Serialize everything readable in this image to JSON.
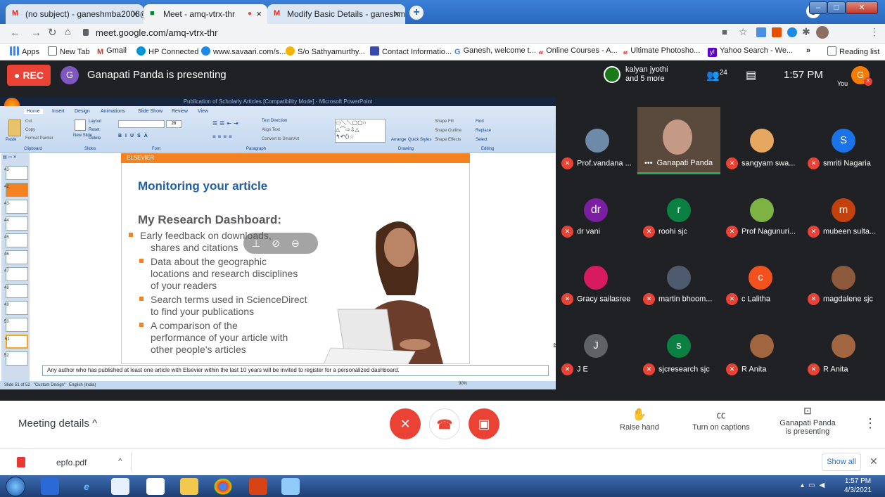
{
  "browser": {
    "tabs": [
      {
        "title": "(no subject) - ganeshmba2008@",
        "icon": "gmail-icon",
        "active": false
      },
      {
        "title": "Meet - amq-vtrx-thr",
        "icon": "meet-icon",
        "active": true
      },
      {
        "title": "Modify Basic Details - ganeshmb",
        "icon": "gmail-icon",
        "active": false
      }
    ],
    "url": "meet.google.com/amq-vtrx-thr",
    "bookmarks": [
      {
        "label": "Apps",
        "icon": "apps-icon"
      },
      {
        "label": "New Tab",
        "icon": "newtab-icon"
      },
      {
        "label": "Gmail",
        "icon": "gmail-icon"
      },
      {
        "label": "HP Connected",
        "icon": "hp-icon"
      },
      {
        "label": "www.savaari.com/s...",
        "icon": "savaari-icon"
      },
      {
        "label": "S/o Sathyamurthy...",
        "icon": "person-icon"
      },
      {
        "label": "Contact Informatio...",
        "icon": "sheet-icon"
      },
      {
        "label": "Ganesh, welcome t...",
        "icon": "google-icon"
      },
      {
        "label": "Online Courses - A...",
        "icon": "udemy-icon"
      },
      {
        "label": "Ultimate Photosho...",
        "icon": "udemy-icon"
      },
      {
        "label": "Yahoo Search - We...",
        "icon": "yahoo-icon"
      }
    ],
    "bookmarks_overflow": "»",
    "reading_list": "Reading list"
  },
  "meet": {
    "rec_label": "REC",
    "presenter_initial": "G",
    "presenter_status": "Ganapati Panda is presenting",
    "pinned": {
      "name": "kalyan jyothi",
      "more": "and 5 more"
    },
    "participants_count": "24",
    "time": "1:57 PM",
    "self_label": "You",
    "self_initial": "G"
  },
  "ppt": {
    "window_title": "Publication of Scholarly Articles [Compatibility Mode] - Microsoft PowerPoint",
    "ribbon_tabs": [
      "Home",
      "Insert",
      "Design",
      "Animations",
      "Slide Show",
      "Review",
      "View"
    ],
    "ribbon_groups": [
      "Clipboard",
      "Slides",
      "Font",
      "Paragraph",
      "Drawing",
      "Editing"
    ],
    "clipboard": [
      "Cut",
      "Copy",
      "Paste",
      "Format Painter"
    ],
    "slides_group": [
      "Layout",
      "Reset",
      "New Slide",
      "Delete"
    ],
    "paragraph_items": [
      "Text Direction",
      "Align Text",
      "Convert to SmartArt"
    ],
    "drawing_items": [
      "Arrange",
      "Quick Styles",
      "Shape Fill",
      "Shape Outline",
      "Shape Effects"
    ],
    "editing_items": [
      "Find",
      "Replace",
      "Select"
    ],
    "font_size": "28",
    "thumb_numbers": [
      "43",
      "42",
      "43",
      "44",
      "45",
      "46",
      "47",
      "48",
      "49",
      "50",
      "51",
      "52"
    ],
    "slide_header": "ELSEVIER",
    "slide_title": "Monitoring your article",
    "slide_subtitle": "My Research Dashboard:",
    "bullets": [
      "Early feedback on downloads,",
      "shares and citations",
      "Data about the geographic",
      "locations and research disciplines",
      "of your readers",
      "Search terms used in ScienceDirect",
      "to find your publications",
      "A comparison of the",
      "performance of your article with",
      "other people's articles"
    ],
    "notes": "Any author who has published at least one article with Elsevier within the last 10 years will be invited to register for a personalized dashboard.",
    "status_slide": "Slide 51 of 52",
    "status_design": "\"Custom Design\"",
    "status_lang": "English (India)",
    "zoom": "90%"
  },
  "participants": [
    {
      "name": "Prof.vandana ...",
      "initial": "",
      "color": "#3c4043",
      "photo": true
    },
    {
      "name": "Ganapati Panda",
      "initial": "",
      "color": "#3c4043",
      "photo": true,
      "speaking": true
    },
    {
      "name": "sangyam swa...",
      "initial": "",
      "color": "#3c4043",
      "photo": true
    },
    {
      "name": "smriti Nagaria",
      "initial": "S",
      "color": "#1a73e8"
    },
    {
      "name": "dr vani",
      "initial": "dr",
      "color": "#7b1fa2"
    },
    {
      "name": "roohi sjc",
      "initial": "r",
      "color": "#0b8043"
    },
    {
      "name": "Prof Nagunuri...",
      "initial": "",
      "color": "#3c4043",
      "photo": true
    },
    {
      "name": "mubeen sulta...",
      "initial": "m",
      "color": "#c2410c"
    },
    {
      "name": "Gracy sailasree",
      "initial": "",
      "color": "#3c4043",
      "photo": true
    },
    {
      "name": "martin bhoom...",
      "initial": "",
      "color": "#3c4043",
      "photo": true
    },
    {
      "name": "c Lalitha",
      "initial": "c",
      "color": "#f4511e"
    },
    {
      "name": "magdalene sjc",
      "initial": "",
      "color": "#3c4043",
      "photo": true
    },
    {
      "name": "J E",
      "initial": "J",
      "color": "#5f6368"
    },
    {
      "name": "sjcresearch sjc",
      "initial": "s",
      "color": "#0b8043"
    },
    {
      "name": "R Anita",
      "initial": "",
      "color": "#3c4043",
      "photo": true
    },
    {
      "name": "R Anita",
      "initial": "",
      "color": "#3c4043",
      "photo": true
    }
  ],
  "controls": {
    "meeting_details": "Meeting details",
    "raise_hand": "Raise hand",
    "captions": "Turn on captions",
    "presenting_line1": "Ganapati Panda",
    "presenting_line2": "is presenting"
  },
  "downloads": {
    "file": "epfo.pdf",
    "show_all": "Show all"
  },
  "taskbar": {
    "time": "1:57 PM",
    "date": "4/3/2021"
  },
  "colors": {
    "accent_red": "#ea4335",
    "meet_bg": "#202124",
    "elsevier_orange": "#f58220",
    "slide_title_blue": "#1f5fa6"
  }
}
